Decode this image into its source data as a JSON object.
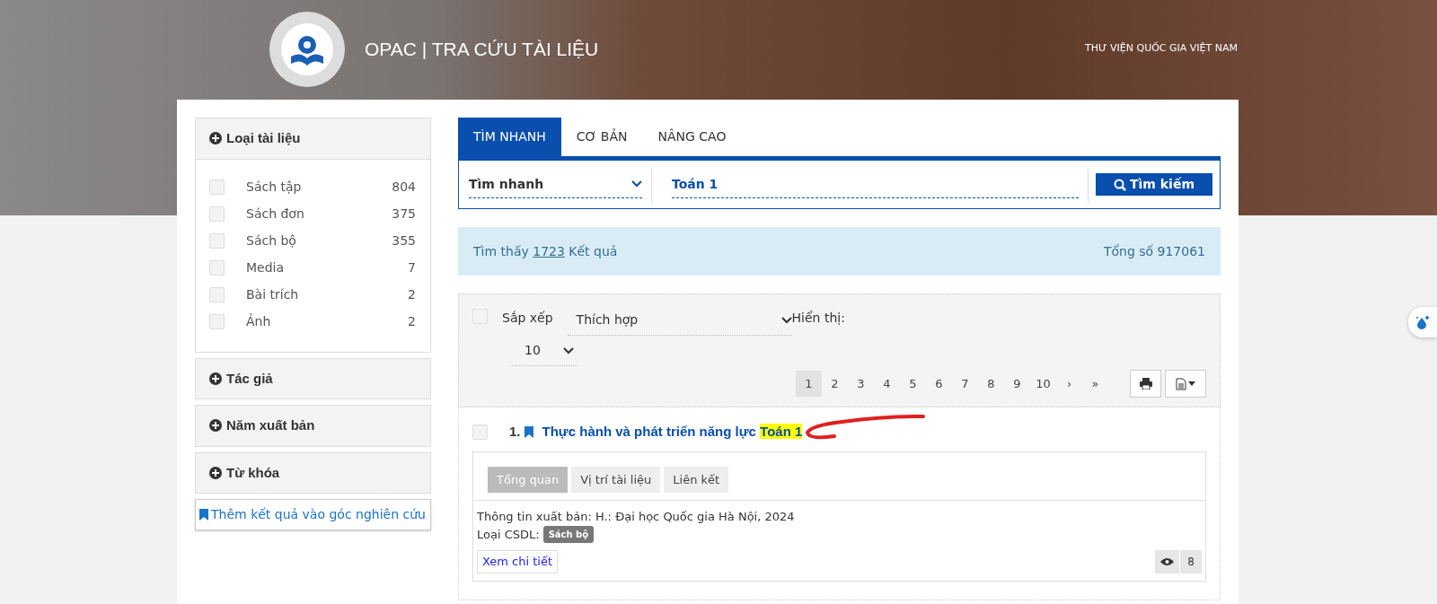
{
  "header": {
    "title": "OPAC | TRA CỨU TÀI LIỆU",
    "library": "THƯ VIỆN QUỐC GIA VIỆT NAM"
  },
  "sidebar": {
    "facets": [
      {
        "title": "Loại tài liệu",
        "items": [
          {
            "label": "Sách tập",
            "count": "804",
            "checked": false
          },
          {
            "label": "Sách đơn",
            "count": "375",
            "checked": false
          },
          {
            "label": "Sách bộ",
            "count": "355",
            "checked": false
          },
          {
            "label": "Media",
            "count": "7",
            "checked": false
          },
          {
            "label": "Bài trích",
            "count": "2",
            "checked": false
          },
          {
            "label": "Ảnh",
            "count": "2",
            "checked": false
          }
        ]
      },
      {
        "title": "Tác giả"
      },
      {
        "title": "Năm xuất bản"
      },
      {
        "title": "Từ khóa"
      }
    ],
    "research_link": "Thêm kết quả vào góc nghiên cứu"
  },
  "search": {
    "tabs": [
      {
        "label": "TÌM NHANH",
        "selected": true
      },
      {
        "label": "CƠ BẢN",
        "selected": false
      },
      {
        "label": "NÂNG CAO",
        "selected": false
      }
    ],
    "field_select": "Tìm nhanh",
    "query": "Toán 1",
    "button": "Tìm kiếm"
  },
  "summary": {
    "prefix": "Tìm thấy",
    "count": "1723",
    "suffix": "Kết quả",
    "total": "Tổng số 917061"
  },
  "toolbar": {
    "select_all_checked": false,
    "sort_label": "Sắp xếp",
    "sort_value": "Thích hợp",
    "display_label": "Hiển thị:",
    "page_size": "10",
    "pages": [
      {
        "label": "1",
        "selected": true
      },
      {
        "label": "2",
        "selected": false
      },
      {
        "label": "3",
        "selected": false
      },
      {
        "label": "4",
        "selected": false
      },
      {
        "label": "5",
        "selected": false
      },
      {
        "label": "6",
        "selected": false
      },
      {
        "label": "7",
        "selected": false
      },
      {
        "label": "8",
        "selected": false
      },
      {
        "label": "9",
        "selected": false
      },
      {
        "label": "10",
        "selected": false
      },
      {
        "label": "›",
        "selected": false
      },
      {
        "label": "»",
        "selected": false
      }
    ]
  },
  "results": [
    {
      "number": "1.",
      "checked": false,
      "title": "Thực hành và phát triển năng lực",
      "title_highlight": "Toán 1",
      "tabs": [
        {
          "label": "Tổng quan",
          "selected": true
        },
        {
          "label": "Vị trí tài liệu",
          "selected": false
        },
        {
          "label": "Liên kết",
          "selected": false
        }
      ],
      "publication": "Thông tin xuất bản: H.: Đại học Quốc gia Hà Nội, 2024",
      "db_label": "Loại CSDL:",
      "db_badge": "Sách bộ",
      "details_link": "Xem chi tiết",
      "views": "8"
    }
  ]
}
